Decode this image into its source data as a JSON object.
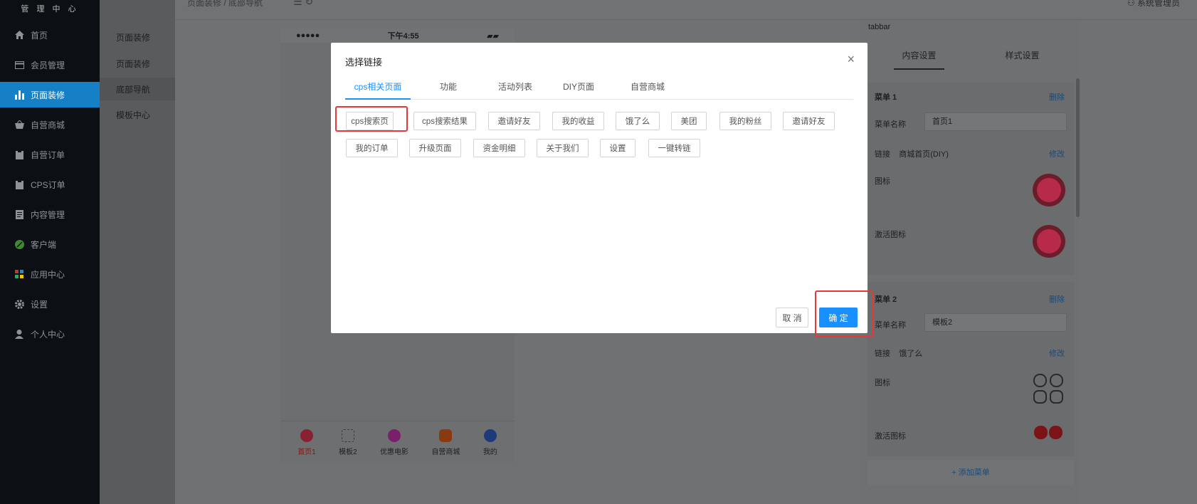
{
  "brand": {
    "subtitle": "管 理 中 心"
  },
  "topbar": {
    "breadcrumb": "页面装修 / 底部导航",
    "admin_label": "系统管理员"
  },
  "sidebar": {
    "items": [
      {
        "label": "首页",
        "icon": "home-icon"
      },
      {
        "label": "会员管理",
        "icon": "card-icon"
      },
      {
        "label": "页面装修",
        "icon": "bar-chart-icon"
      },
      {
        "label": "自营商城",
        "icon": "basket-icon"
      },
      {
        "label": "自营订单",
        "icon": "clipboard-icon"
      },
      {
        "label": "CPS订单",
        "icon": "clipboard-icon"
      },
      {
        "label": "内容管理",
        "icon": "document-icon"
      },
      {
        "label": "客户端",
        "icon": "leaf-icon"
      },
      {
        "label": "应用中心",
        "icon": "apps-icon"
      },
      {
        "label": "设置",
        "icon": "gear-icon"
      },
      {
        "label": "个人中心",
        "icon": "user-icon"
      }
    ],
    "active_index": 2
  },
  "subnav": {
    "items": [
      "页面装修",
      "页面装修",
      "底部导航",
      "模板中心"
    ],
    "active_index": 2
  },
  "phone": {
    "signal": "●●●●●",
    "time": "下午4:55",
    "battery": "▰▰",
    "tabs": [
      {
        "label": "首页1",
        "color": "#8a2033"
      },
      {
        "label": "模板2",
        "color": "#5a5c5e"
      },
      {
        "label": "优惠电影",
        "color": "#7a1f6a"
      },
      {
        "label": "自营商城",
        "color": "#8a3a10"
      },
      {
        "label": "我的",
        "color": "#1f3a7a"
      }
    ]
  },
  "right_panel": {
    "title": "tabbar",
    "tabs": [
      "内容设置",
      "样式设置"
    ],
    "menus": [
      {
        "heading": "菜单 1",
        "delete": "删除",
        "name_label": "菜单名称",
        "name_value": "首页1",
        "link_label": "链接",
        "link_value": "商城首页(DIY)",
        "edit": "修改",
        "icon_label": "图标",
        "active_icon_label": "激活图标"
      },
      {
        "heading": "菜单 2",
        "delete": "删除",
        "name_label": "菜单名称",
        "name_value": "模板2",
        "link_label": "链接",
        "link_value": "饿了么",
        "edit": "修改",
        "icon_label": "图标",
        "active_icon_label": "激活图标"
      }
    ],
    "add_menu": "+ 添加菜单"
  },
  "modal": {
    "title": "选择链接",
    "close": "×",
    "tabs": [
      "cps相关页面",
      "功能",
      "活动列表",
      "DIY页面",
      "自营商城"
    ],
    "active_tab": 0,
    "options_row1": [
      "cps搜索页",
      "cps搜索结果",
      "邀请好友",
      "我的收益",
      "饿了么",
      "美团",
      "我的粉丝",
      "邀请好友"
    ],
    "options_row2": [
      "我的订单",
      "升级页面",
      "资金明细",
      "关于我们",
      "设置",
      "一键转链"
    ],
    "selected_option": "cps搜索页",
    "cancel": "取 消",
    "confirm": "确 定",
    "accent_color": "#1890ff",
    "highlight_color": "#e53935"
  }
}
